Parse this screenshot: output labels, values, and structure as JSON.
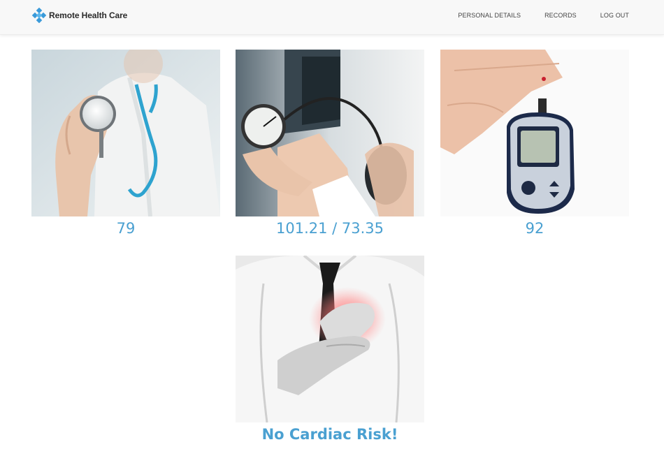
{
  "app": {
    "brand_name": "Remote Health Care",
    "brand_icon": "diamond-cluster-logo",
    "accent_color": "#4aa0d1"
  },
  "nav": {
    "items": [
      {
        "label": "PERSONAL DETAILS"
      },
      {
        "label": "RECORDS"
      },
      {
        "label": "LOG OUT"
      }
    ]
  },
  "vitals": {
    "heart_rate": {
      "value": "79",
      "image": "stethoscope-doctor-photo"
    },
    "blood_pressure": {
      "value": "101.21 / 73.35",
      "image": "blood-pressure-cuff-photo"
    },
    "blood_sugar": {
      "value": "92",
      "image": "glucose-meter-photo"
    },
    "cardiac": {
      "value": "No Cardiac Risk!",
      "image": "chest-pain-photo"
    }
  }
}
